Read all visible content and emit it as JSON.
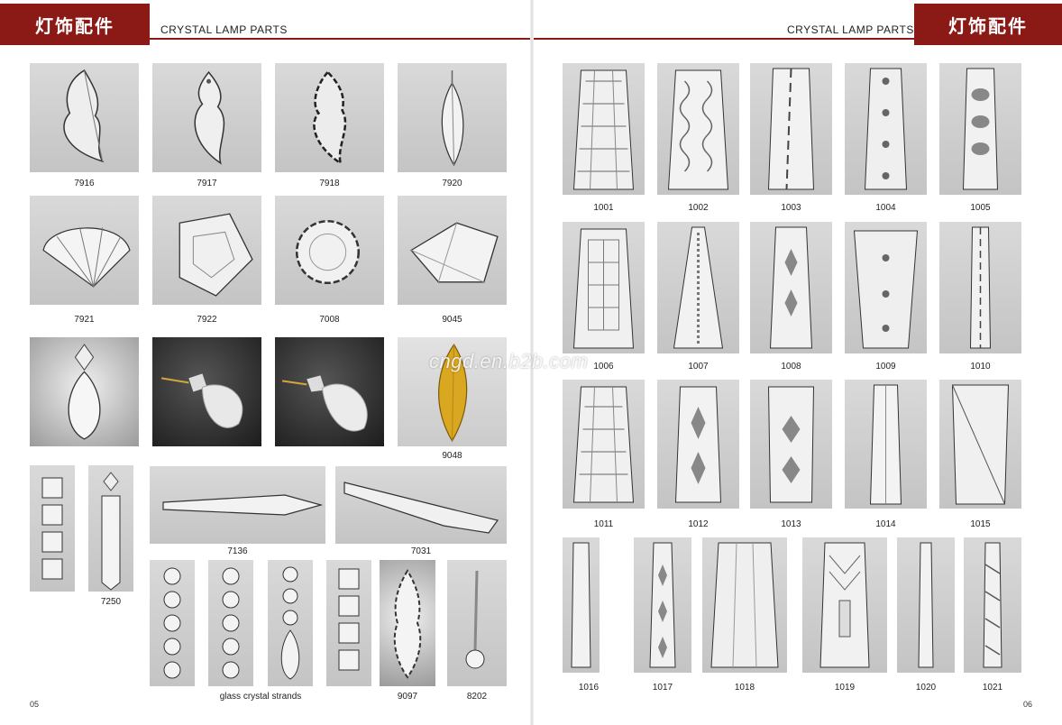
{
  "header": {
    "left_chinese": "灯饰配件",
    "left_title": "CRYSTAL LAMP PARTS",
    "right_title": "CRYSTAL LAMP PARTS",
    "right_chinese": "灯饰配件"
  },
  "watermark": "cngd.en.b2b.com",
  "left_page": {
    "row1": [
      "7916",
      "7917",
      "7918",
      "7920"
    ],
    "row2": [
      "7921",
      "7922",
      "7008",
      "9045"
    ],
    "row3": [
      "9048"
    ],
    "bottom": {
      "strand_7250": "7250",
      "icicle_7136": "7136",
      "icicle_7031": "7031",
      "strands_caption": "glass crystal strands",
      "item_9097": "9097",
      "item_8202": "8202"
    },
    "page_number": "05"
  },
  "right_page": {
    "row1": [
      "1001",
      "1002",
      "1003",
      "1004",
      "1005"
    ],
    "row2": [
      "1006",
      "1007",
      "1008",
      "1009",
      "1010"
    ],
    "row3": [
      "1011",
      "1012",
      "1013",
      "1014",
      "1015"
    ],
    "row4": [
      "1016",
      "1017",
      "1018",
      "1019",
      "1020",
      "1021"
    ],
    "page_number": "06"
  },
  "colors": {
    "accent": "#8b1a16"
  }
}
